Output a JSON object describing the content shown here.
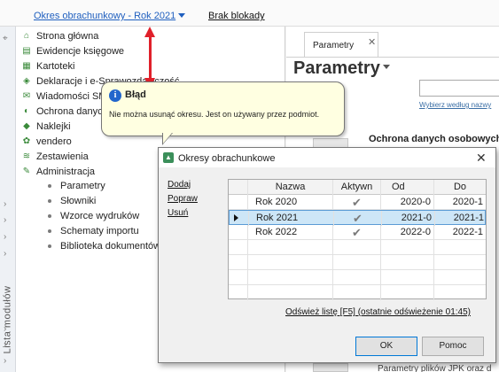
{
  "topbar": {
    "period_label": "Okres obrachunkowy - Rok 2021",
    "lock_label": "Brak blokady"
  },
  "rail": {
    "label": "Lista modułów"
  },
  "sidebar": {
    "items": [
      {
        "label": "Strona główna",
        "icon": "home-icon"
      },
      {
        "label": "Ewidencje księgowe",
        "icon": "ledger-icon"
      },
      {
        "label": "Kartoteki",
        "icon": "cards-icon"
      },
      {
        "label": "Deklaracje i e-Sprawozdawczość",
        "icon": "declaration-icon"
      },
      {
        "label": "Wiadomości SMS",
        "icon": "sms-icon"
      },
      {
        "label": "Ochrona danych",
        "icon": "shield-icon"
      },
      {
        "label": "Naklejki",
        "icon": "sticker-icon"
      },
      {
        "label": "vendero",
        "icon": "vendero-icon"
      },
      {
        "label": "Zestawienia",
        "icon": "reports-icon"
      },
      {
        "label": "Administracja",
        "icon": "admin-icon"
      }
    ],
    "subitems": [
      {
        "label": "Parametry"
      },
      {
        "label": "Słowniki"
      },
      {
        "label": "Wzorce wydruków"
      },
      {
        "label": "Schematy importu"
      },
      {
        "label": "Biblioteka dokumentów"
      }
    ]
  },
  "content": {
    "tab_label": "Parametry",
    "page_title": "Parametry",
    "search_hint": "Wybierz według nazwy",
    "section_title": "Ochrona danych osobowych",
    "bottom_text": "Parametry plików JPK oraz d"
  },
  "tooltip": {
    "title": "Błąd",
    "message": "Nie można usunąć okresu. Jest on używany przez podmiot."
  },
  "dialog": {
    "title": "Okresy obrachunkowe",
    "side_links": [
      "Dodaj",
      "Popraw",
      "Usuń"
    ],
    "columns": [
      "Nazwa",
      "Aktywn",
      "Od",
      "Do"
    ],
    "rows": [
      {
        "nazwa": "Rok 2020",
        "aktywny": "✔",
        "od": "2020-0",
        "do": "2020-1"
      },
      {
        "nazwa": "Rok 2021",
        "aktywny": "✔",
        "od": "2021-0",
        "do": "2021-1"
      },
      {
        "nazwa": "Rok 2022",
        "aktywny": "✔",
        "od": "2022-0",
        "do": "2022-1"
      }
    ],
    "refresh_label": "Odśwież listę [F5] (ostatnie odświeżenie 01:45)",
    "ok_label": "OK",
    "help_label": "Pomoc"
  },
  "colors": {
    "link": "#1f5fbf",
    "arrow": "#e0202a",
    "tooltip_bg": "#ffffe1",
    "selection": "#cde6f7"
  }
}
